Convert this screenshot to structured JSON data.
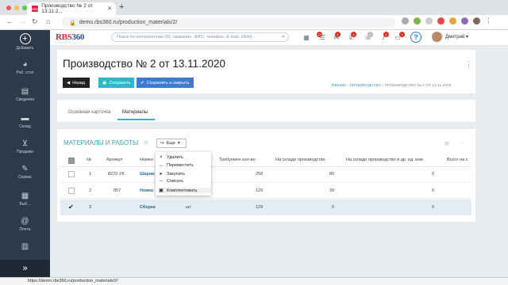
{
  "browser": {
    "tab_title": "Производство № 2 от 13.11.2...",
    "tab_favicon": "rbs",
    "url": "demo.rbs360.ru/production_materials/2/",
    "status_url": "https://demo.rbs360.ru/production_materials/2/"
  },
  "sidebar": {
    "items": [
      {
        "label": "Добавить",
        "icon": "plus-circle-icon"
      },
      {
        "label": "Раб. стол",
        "icon": "pie-chart-icon"
      },
      {
        "label": "Сведения",
        "icon": "id-card-icon"
      },
      {
        "label": "Склад",
        "icon": "truck-icon"
      },
      {
        "label": "Продажи",
        "icon": "cart-icon"
      },
      {
        "label": "Сервис",
        "icon": "wrench-icon"
      },
      {
        "label": "Быб...",
        "icon": "building-icon"
      },
      {
        "label": "Почта",
        "icon": "at-icon"
      },
      {
        "label": "",
        "icon": "bar-chart-icon"
      }
    ],
    "collapse_icon": "»"
  },
  "topbar": {
    "logo_main": "RBS",
    "logo_num": "360",
    "search_placeholder": "Поиск по контрагентам (ID, название, ФИО, телефон, E-mail, ИНН)...",
    "badges": [
      "14",
      "1",
      "1",
      "1",
      "1",
      "1"
    ],
    "help": "?",
    "user_name": "Дмитрий ▾"
  },
  "header": {
    "title": "Производство № 2 от 13.11.2020",
    "buttons": {
      "back": "Назад",
      "save": "Сохранить",
      "save_close": "Сохранить и закрыть"
    },
    "breadcrumb": {
      "root": "RBS360",
      "sep": "›",
      "section": "ПРОИЗВОДСТВО",
      "current": "ПРОИЗВОДСТВО № 2 ОТ 13.11.2020"
    }
  },
  "tabs": {
    "main_card": "Основная карточка",
    "materials": "Материалы"
  },
  "materials": {
    "section_title": "МАТЕРИАЛЫ И РАБОТЫ",
    "more_button": "Еще",
    "columns": [
      "№",
      "Артикул",
      "Номен",
      "Требуемое кол-во",
      "На складе производство",
      "На складе производство в др. ед. изм.",
      "Всего на с"
    ],
    "rows": [
      {
        "n": "1",
        "sku": "8222-УК",
        "name": "Шарни",
        "unit": "",
        "qty": "258",
        "stock": "80",
        "stock_alt": "0"
      },
      {
        "n": "2",
        "sku": "857",
        "name": "Ножка",
        "unit": "",
        "qty": "129",
        "stock": "39",
        "stock_alt": "0"
      },
      {
        "n": "3",
        "sku": "",
        "name": "Сборка",
        "unit": "шт",
        "qty": "129",
        "stock": "0",
        "stock_alt": "0"
      }
    ],
    "dropdown": [
      {
        "label": "Удалить",
        "icon": "×"
      },
      {
        "label": "Переместить",
        "icon": "↔"
      },
      {
        "label": "Закупить",
        "icon": "▸"
      },
      {
        "label": "Списать",
        "icon": "–"
      },
      {
        "label": "Комплектовать",
        "icon": "▣"
      }
    ]
  }
}
